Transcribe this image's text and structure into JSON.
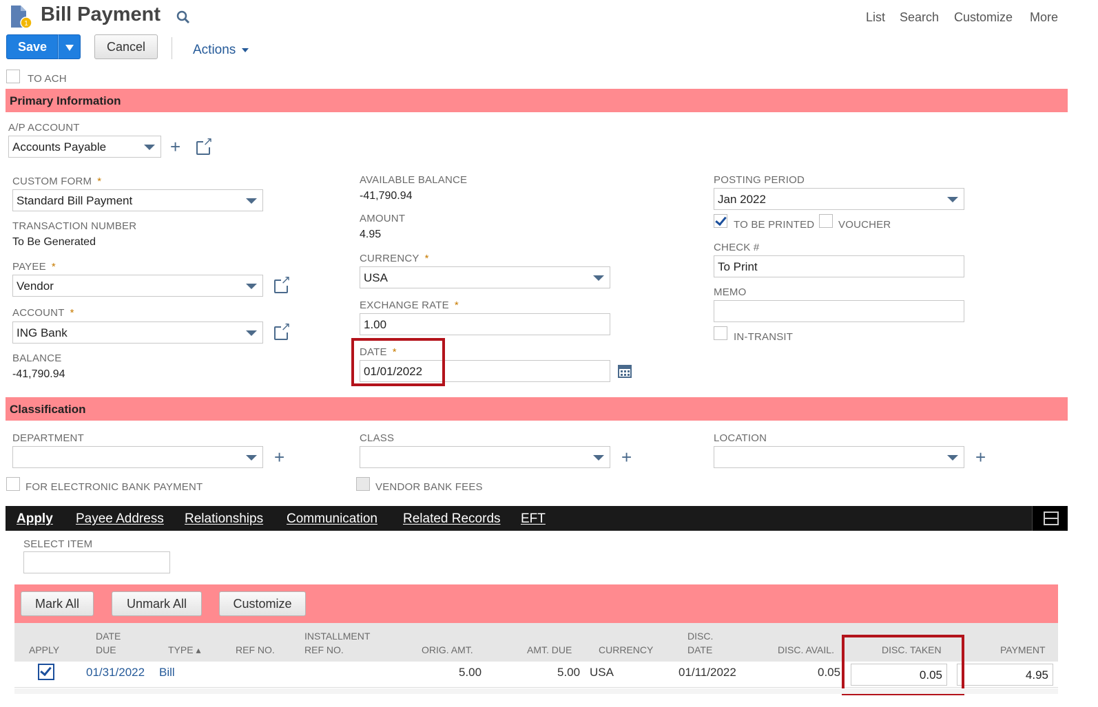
{
  "header": {
    "title": "Bill Payment",
    "nav": {
      "list": "List",
      "search": "Search",
      "customize": "Customize",
      "more": "More"
    }
  },
  "toolbar": {
    "save_label": "Save",
    "cancel_label": "Cancel",
    "actions_label": "Actions"
  },
  "to_ach_label": "TO ACH",
  "primary": {
    "section_title": "Primary Information",
    "ap_account": {
      "label": "A/P ACCOUNT",
      "value": "Accounts Payable"
    },
    "custom_form": {
      "label": "CUSTOM FORM",
      "value": "Standard Bill Payment"
    },
    "transaction_number": {
      "label": "TRANSACTION NUMBER",
      "value": "To Be Generated"
    },
    "payee": {
      "label": "PAYEE",
      "value": "Vendor"
    },
    "account": {
      "label": "ACCOUNT",
      "value": "ING Bank"
    },
    "balance": {
      "label": "BALANCE",
      "value": "-41,790.94"
    },
    "available_balance": {
      "label": "AVAILABLE BALANCE",
      "value": "-41,790.94"
    },
    "amount": {
      "label": "AMOUNT",
      "value": "4.95"
    },
    "currency": {
      "label": "CURRENCY",
      "value": "USA"
    },
    "exchange_rate": {
      "label": "EXCHANGE RATE",
      "value": "1.00"
    },
    "date": {
      "label": "DATE",
      "value": "01/01/2022"
    },
    "posting_period": {
      "label": "POSTING PERIOD",
      "value": "Jan 2022"
    },
    "to_be_printed": {
      "label": "TO BE PRINTED",
      "checked": true
    },
    "voucher": {
      "label": "VOUCHER",
      "checked": false
    },
    "check_no": {
      "label": "CHECK #",
      "value": "To Print"
    },
    "memo": {
      "label": "MEMO",
      "value": ""
    },
    "in_transit": {
      "label": "IN-TRANSIT",
      "checked": false
    }
  },
  "classification": {
    "section_title": "Classification",
    "department_label": "DEPARTMENT",
    "class_label": "CLASS",
    "location_label": "LOCATION",
    "electronic_payment_label": "FOR ELECTRONIC BANK PAYMENT",
    "vendor_bank_fees_label": "VENDOR BANK FEES"
  },
  "tabs": [
    "Apply",
    "Payee Address",
    "Relationships",
    "Communication",
    "Related Records",
    "EFT"
  ],
  "apply": {
    "select_item_label": "SELECT ITEM",
    "buttons": {
      "mark_all": "Mark All",
      "unmark_all": "Unmark All",
      "customize": "Customize"
    },
    "columns": {
      "apply": "APPLY",
      "date_due_1": "DATE",
      "date_due_2": "DUE",
      "type": "TYPE ▴",
      "ref_no": "REF NO.",
      "installment_1": "INSTALLMENT",
      "installment_2": "REF NO.",
      "orig_amt": "ORIG. AMT.",
      "amt_due": "AMT. DUE",
      "currency": "CURRENCY",
      "disc_date_1": "DISC.",
      "disc_date_2": "DATE",
      "disc_avail": "DISC. AVAIL.",
      "disc_taken": "DISC. TAKEN",
      "payment": "PAYMENT"
    },
    "rows": [
      {
        "apply": true,
        "date_due": "01/31/2022",
        "type": "Bill",
        "ref_no": "",
        "installment_ref": "",
        "orig_amt": "5.00",
        "amt_due": "5.00",
        "currency": "USA",
        "disc_date": "01/11/2022",
        "disc_avail": "0.05",
        "disc_taken": "0.05",
        "payment": "4.95"
      }
    ]
  },
  "colors": {
    "section_bg": "#ff8a8f",
    "save_blue": "#1f7fe0",
    "highlight_border": "#b3131b",
    "tabbar_bg": "#1a1a1a"
  }
}
